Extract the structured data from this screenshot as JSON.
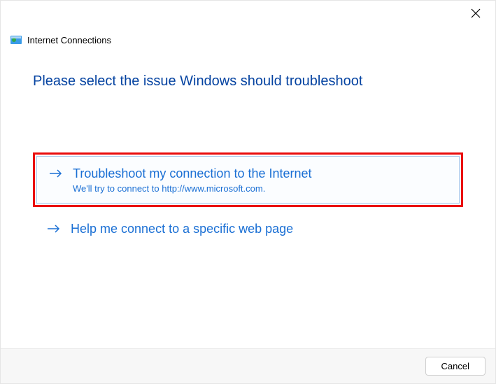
{
  "window": {
    "title": "Internet Connections"
  },
  "heading": "Please select the issue Windows should troubleshoot",
  "options": [
    {
      "title": "Troubleshoot my connection to the Internet",
      "subtitle": "We'll try to connect to http://www.microsoft.com."
    },
    {
      "title": "Help me connect to a specific web page",
      "subtitle": ""
    }
  ],
  "footer": {
    "cancel": "Cancel"
  }
}
